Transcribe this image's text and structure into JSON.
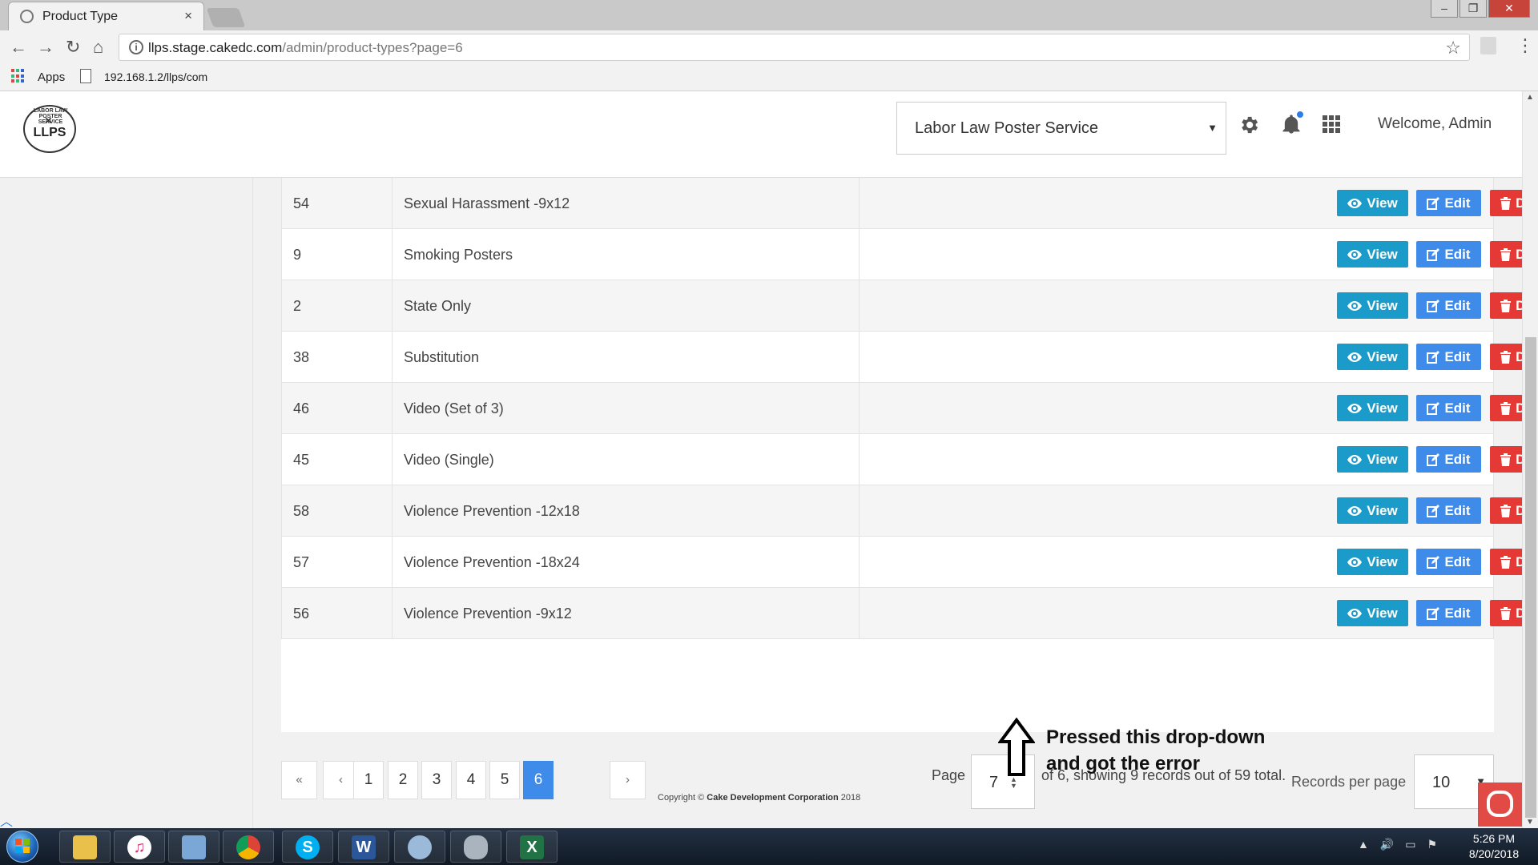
{
  "browser": {
    "tab_title": "Product Type",
    "tab_close": "×",
    "url_host": "llps.stage.cakedc.com",
    "url_path": "/admin/product-types?page=6",
    "bookmarks": {
      "apps_label": "Apps",
      "link": "192.168.1.2/llps/com"
    }
  },
  "header": {
    "logo_text": "LLPS",
    "logo_arc": "LABOR LAW POSTER SERVICE",
    "company_select": "Labor Law Poster Service",
    "welcome": "Welcome, Admin"
  },
  "table": {
    "rows": [
      {
        "id": "54",
        "name": "Sexual Harassment -9x12"
      },
      {
        "id": "9",
        "name": "Smoking Posters"
      },
      {
        "id": "2",
        "name": "State Only"
      },
      {
        "id": "38",
        "name": "Substitution"
      },
      {
        "id": "46",
        "name": "Video (Set of 3)"
      },
      {
        "id": "45",
        "name": "Video (Single)"
      },
      {
        "id": "58",
        "name": "Violence Prevention -12x18"
      },
      {
        "id": "57",
        "name": "Violence Prevention -18x24"
      },
      {
        "id": "56",
        "name": "Violence Prevention -9x12"
      }
    ],
    "actions": {
      "view": "View",
      "edit": "Edit",
      "delete": "Delete"
    }
  },
  "pagination": {
    "first": "«",
    "prev": "‹",
    "pages": [
      "1",
      "2",
      "3",
      "4",
      "5",
      "6"
    ],
    "current": "6",
    "next": "›",
    "page_label": "Page",
    "page_input_value": "7",
    "page_info": "of 6, showing 9 records out of 59 total.",
    "records_per_page_label": "Records per page",
    "records_per_page_value": "10"
  },
  "annotation": {
    "line1": "Pressed this drop-down",
    "line2": "and got the error"
  },
  "footer": {
    "prefix": "Copyright © ",
    "company": "Cake Development Corporation",
    "year": " 2018"
  },
  "taskbar": {
    "time": "5:26 PM",
    "date": "8/20/2018"
  },
  "colors": {
    "view": "#1a9bc9",
    "edit": "#3f8bea",
    "delete": "#e53935",
    "active_page": "#3f8bea"
  }
}
